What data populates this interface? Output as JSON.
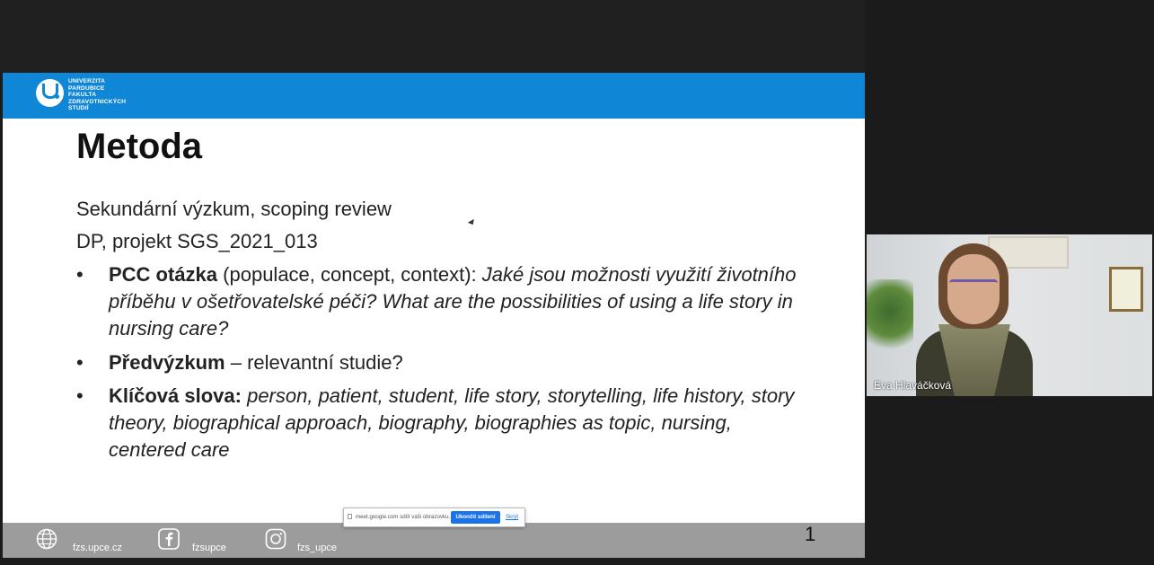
{
  "slide": {
    "logo_lines": [
      "UNIVERZITA",
      "PARDUBICE",
      "FAKULTA",
      "ZDRAVOTNICKÝCH",
      "STUDIÍ"
    ],
    "title": "Metoda",
    "line1": "Sekundární výzkum, scoping review",
    "line2": "DP, projekt SGS_2021_013",
    "bullets": [
      {
        "bold": "PCC otázka",
        "normal": " (populace, concept, context): ",
        "italic": "Jaké jsou možnosti využití životního příběhu v ošetřovatelské péči? What are the possibilities of using a life story in nursing care?"
      },
      {
        "bold": "Předvýzkum",
        "normal": " – relevantní studie?",
        "italic": ""
      },
      {
        "bold": "Klíčová slova:",
        "normal": " ",
        "italic": "person, patient, student, life story, storytelling, life history, story theory, biographical approach, biography, biographies as topic, nursing, centered care"
      }
    ],
    "footer": {
      "web": "fzs.upce.cz",
      "facebook": "fzsupce",
      "instagram": "fzs_upce"
    },
    "page_number": "1"
  },
  "share_bar": {
    "text": "meet.google.com sdílí vaši obrazovku.",
    "stop_label": "Ukončit sdílení",
    "hide_label": "Skrýt"
  },
  "participant": {
    "name": "Eva Hlaváčková"
  },
  "colors": {
    "header_blue": "#0f86d6",
    "footer_gray": "#9c9c9c",
    "button_blue": "#1a73e8"
  },
  "icons": [
    "globe-icon",
    "facebook-icon",
    "instagram-icon",
    "share-screen-icon"
  ]
}
